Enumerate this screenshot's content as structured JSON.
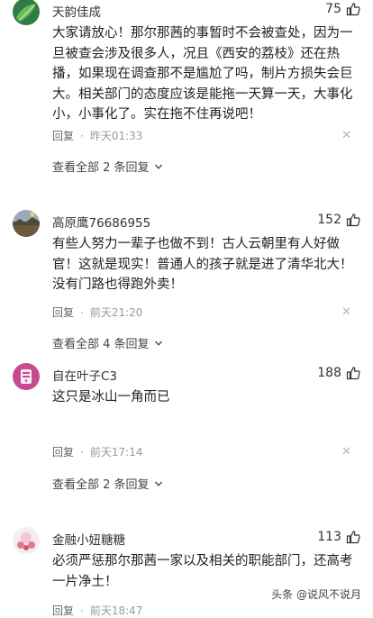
{
  "comments": [
    {
      "username": "天韵佳成",
      "likes": "75",
      "content": "大家请放心！那尔那茜的事暂时不会被查处，因为一旦被查会涉及很多人，况且《西安的荔枝》还在热播，如果现在调查那不是尴尬了吗，制片方损失会巨大。相关部门的态度应该是能拖一天算一天，大事化小，小事化了。实在拖不住再说吧！",
      "reply_label": "回复",
      "time": "昨天01:33",
      "view_replies": "查看全部 2 条回复"
    },
    {
      "username": "高原鹰76686955",
      "likes": "152",
      "content": "有些人努力一辈子也做不到！古人云朝里有人好做官！这就是现实！普通人的孩子就是进了清华北大！没有门路也得跑外卖！",
      "reply_label": "回复",
      "time": "前天21:20",
      "view_replies": "查看全部 4 条回复"
    },
    {
      "username": "自在叶子C3",
      "likes": "188",
      "content": "这只是冰山一角而已",
      "reply_label": "回复",
      "time": "前天17:14",
      "view_replies": "查看全部 2 条回复"
    },
    {
      "username": "金融小妞糖糖",
      "likes": "113",
      "content": "必须严惩那尔那茜一家以及相关的职能部门，还高考一片净土！",
      "reply_label": "回复",
      "time": "前天18:47"
    }
  ],
  "watermark": "头条 @说风不说月",
  "icons": {
    "like": "thumbs-up-icon",
    "close": "close-icon",
    "expand": "chevron-down-icon"
  }
}
